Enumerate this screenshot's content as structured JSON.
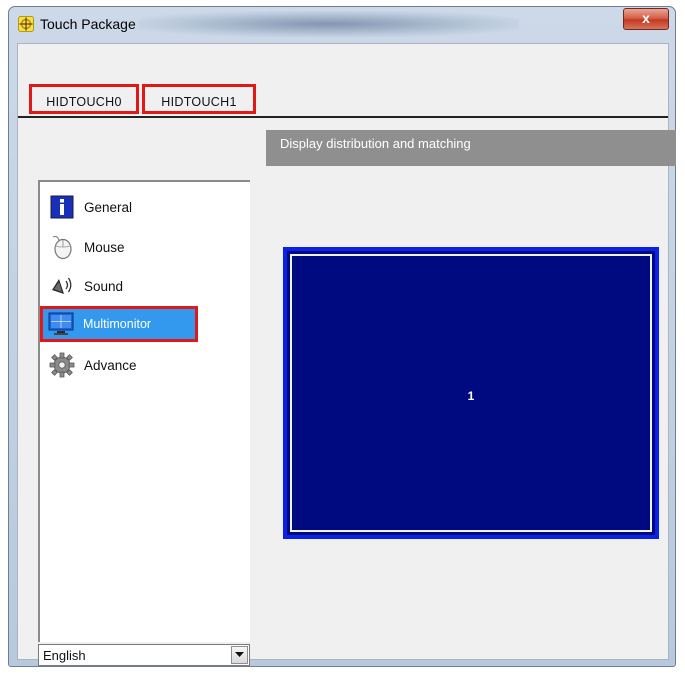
{
  "window": {
    "title": "Touch Package",
    "close_label": "x"
  },
  "tabs": [
    {
      "label": "HIDTOUCH0"
    },
    {
      "label": "HIDTOUCH1"
    }
  ],
  "content": {
    "header": "Display distribution and matching",
    "monitor_label": "1"
  },
  "nav": {
    "items": [
      {
        "label": "General",
        "icon": "info-icon"
      },
      {
        "label": "Mouse",
        "icon": "mouse-icon"
      },
      {
        "label": "Sound",
        "icon": "speaker-icon"
      },
      {
        "label": "Multimonitor",
        "icon": "monitor-icon",
        "selected": true
      },
      {
        "label": "Advance",
        "icon": "gear-icon"
      }
    ]
  },
  "language": {
    "selected": "English"
  },
  "colors": {
    "highlight_red": "#e01818",
    "selection_blue": "#3399ee",
    "monitor_fill": "#000a80",
    "monitor_border": "#0a22e8",
    "header_gray": "#8f8f8f"
  }
}
